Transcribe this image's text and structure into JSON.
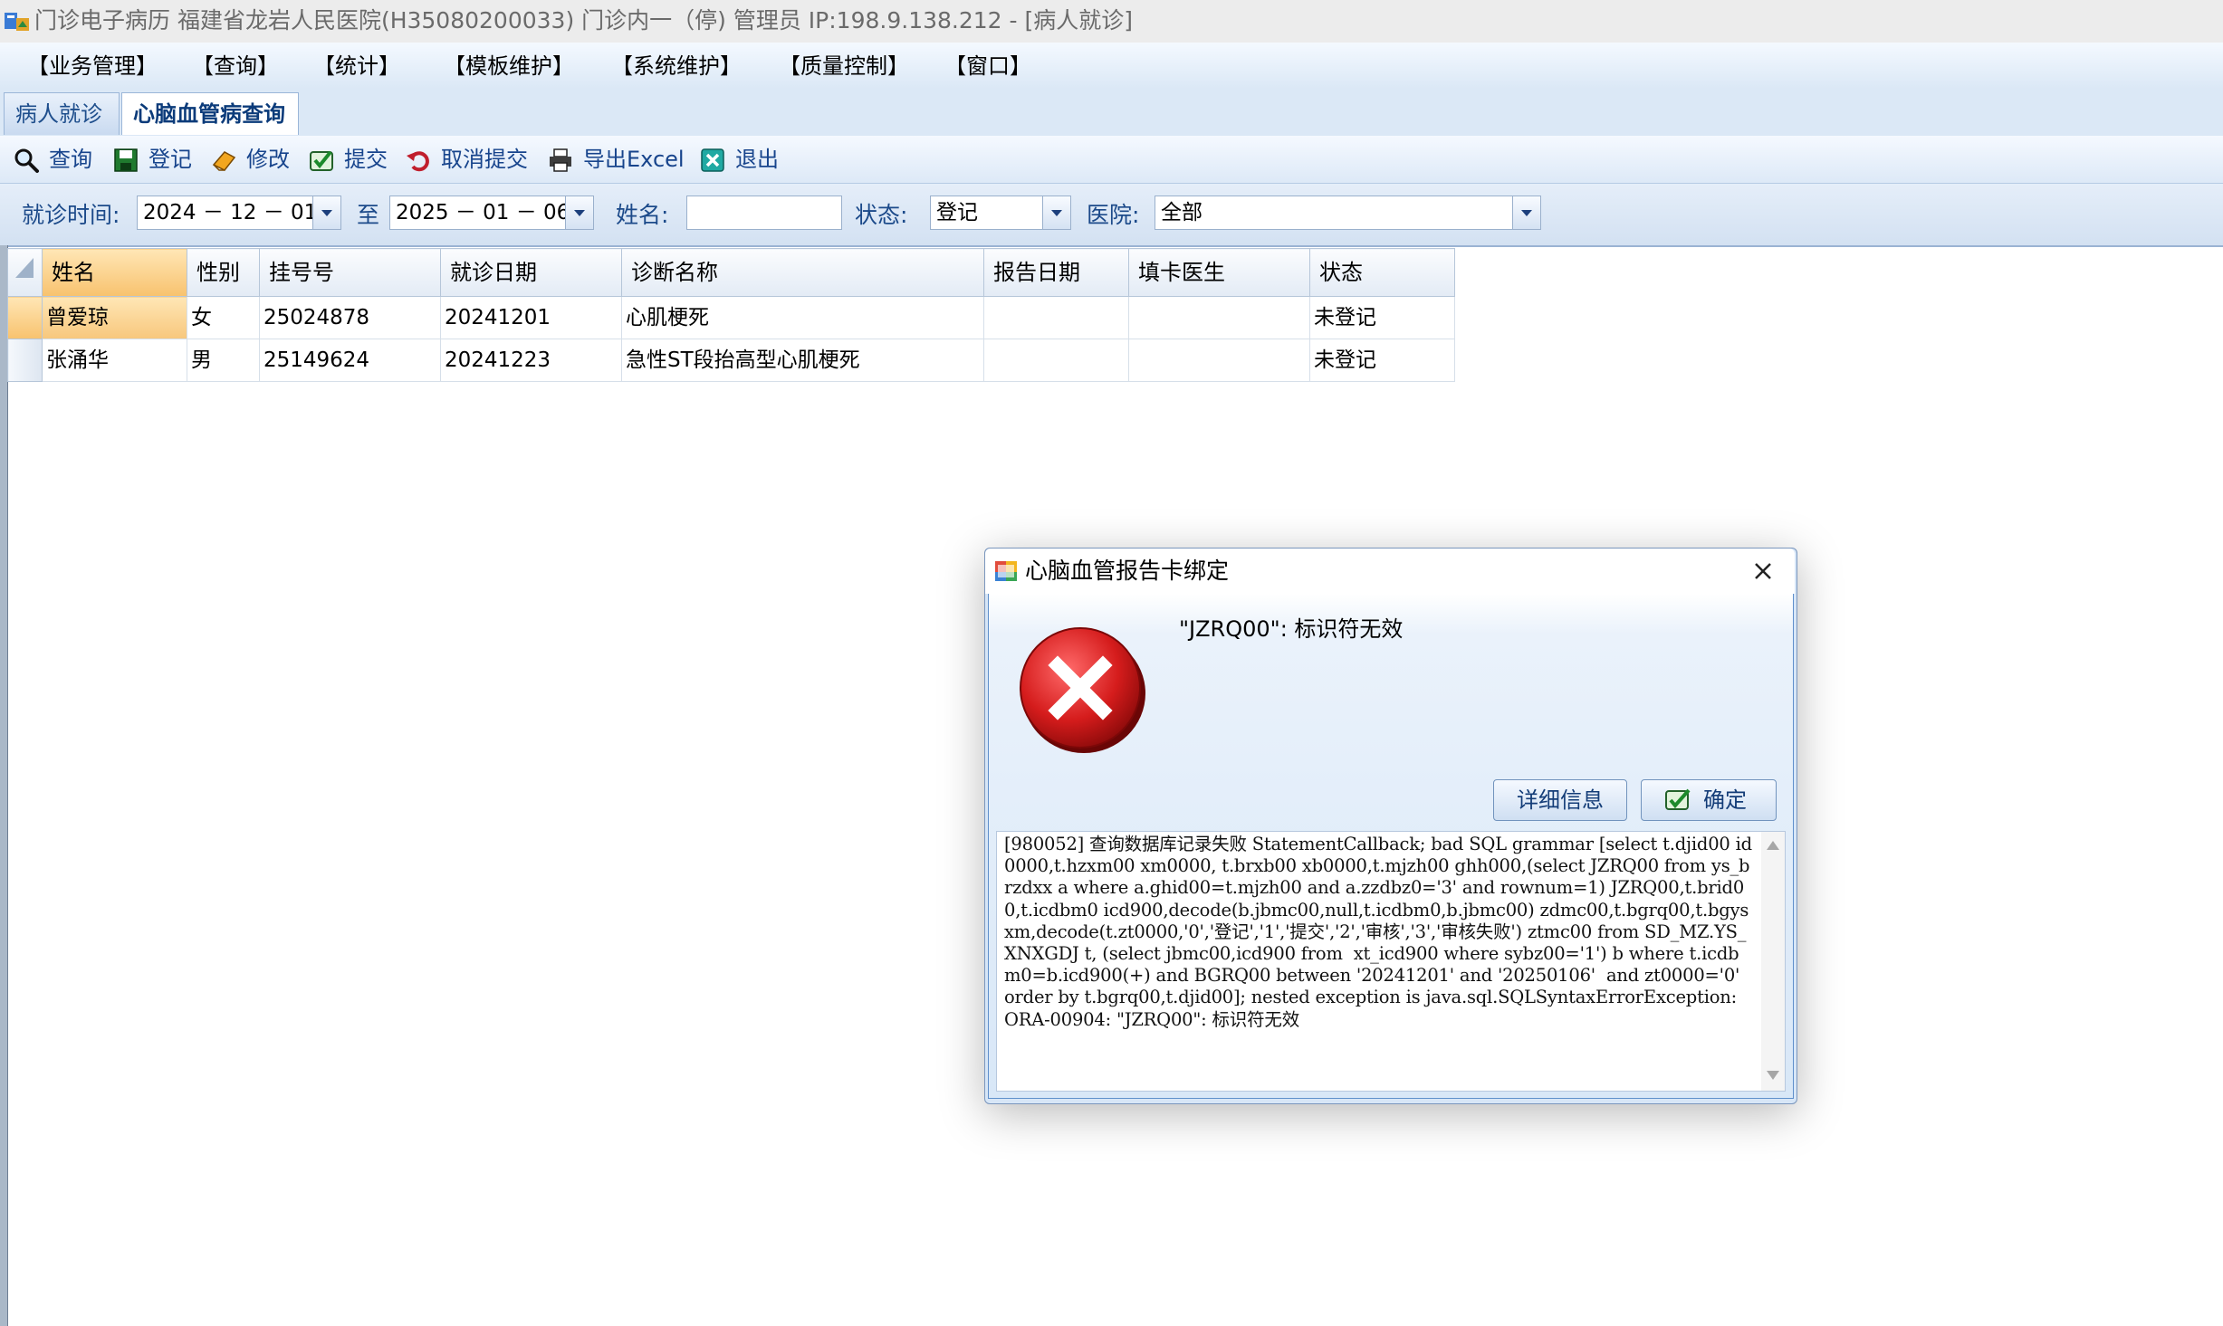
{
  "window": {
    "title": "门诊电子病历  福建省龙岩人民医院(H35080200033) 门诊内一（停)    管理员 IP:198.9.138.212 - [病人就诊]"
  },
  "menu": [
    "【业务管理】",
    "【查询】",
    "【统计】",
    "【模板维护】",
    "【系统维护】",
    "【质量控制】",
    "【窗口】"
  ],
  "tabs": [
    {
      "label": "病人就诊",
      "active": false
    },
    {
      "label": "心脑血管病查询",
      "active": true
    }
  ],
  "toolbar": {
    "query": "查询",
    "register": "登记",
    "modify": "修改",
    "submit": "提交",
    "cancel_submit": "取消提交",
    "export_excel": "导出Excel",
    "exit": "退出"
  },
  "filters": {
    "date_label": "就诊时间:",
    "date_from": "2024 － 12 － 01",
    "to_label": "至",
    "date_to": "2025 － 01 － 06",
    "name_label": "姓名:",
    "name_value": "",
    "status_label": "状态:",
    "status_value": "登记",
    "hospital_label": "医院:",
    "hospital_value": "全部"
  },
  "grid": {
    "columns": [
      "姓名",
      "性别",
      "挂号号",
      "就诊日期",
      "诊断名称",
      "报告日期",
      "填卡医生",
      "状态"
    ],
    "rows": [
      [
        "曾爱琼",
        "女",
        "25024878",
        "20241201",
        "心肌梗死",
        "",
        "",
        "未登记"
      ],
      [
        "张涌华",
        "男",
        "25149624",
        "20241223",
        "急性ST段抬高型心肌梗死",
        "",
        "",
        "未登记"
      ]
    ]
  },
  "dialog": {
    "title": "心脑血管报告卡绑定",
    "message": "\"JZRQ00\": 标识符无效",
    "details_button": "详细信息",
    "ok_button": "确定",
    "detail_text": "[980052] 查询数据库记录失败 StatementCallback; bad SQL grammar [select t.djid00 id0000,t.hzxm00 xm0000, t.brxb00 xb0000,t.mjzh00 ghh000,(select JZRQ00 from ys_brzdxx a where a.ghid00=t.mjzh00 and a.zzdbz0='3' and rownum=1) JZRQ00,t.brid00,t.icdbm0 icd900,decode(b.jbmc00,null,t.icdbm0,b.jbmc00) zdmc00,t.bgrq00,t.bgysxm,decode(t.zt0000,'0','登记','1','提交','2','审核','3','审核失败') ztmc00 from SD_MZ.YS_XNXGDJ t, (select jbmc00,icd900 from  xt_icd900 where sybz00='1') b where t.icdbm0=b.icd900(+) and BGRQ00 between '20241201' and '20250106'  and zt0000='0'  order by t.bgrq00,t.djid00]; nested exception is java.sql.SQLSyntaxErrorException: ORA-00904: \"JZRQ00\": 标识符无效"
  },
  "icons": {
    "app": "app-icon",
    "query": "magnifier-icon",
    "register": "save-disk-icon",
    "modify": "eraser-icon",
    "submit": "check-icon",
    "cancel_submit": "undo-icon",
    "export_excel": "printer-icon",
    "exit": "exit-icon",
    "dialog": "window-icon",
    "error": "error-x-icon",
    "close": "close-icon"
  },
  "colors": {
    "accent": "#3d6fb0",
    "selected": "#f8c26e",
    "error": "#d42a2a"
  }
}
